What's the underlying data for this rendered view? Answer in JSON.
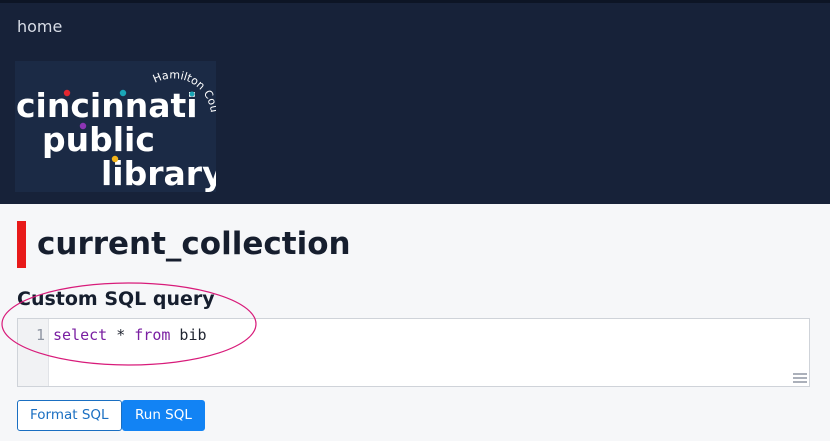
{
  "nav": {
    "home_label": "home"
  },
  "logo": {
    "line1": "cincinnati",
    "line2": "public",
    "line3": "library",
    "arc_text": "Hamilton County",
    "alt": "Cincinnati & Hamilton County Public Library logo"
  },
  "page": {
    "title": "current_collection",
    "section_title": "Custom SQL query"
  },
  "editor": {
    "line_number": "1",
    "keyword_select": "select",
    "star": " * ",
    "keyword_from": "from",
    "table": " bib"
  },
  "buttons": {
    "format_label": "Format SQL",
    "run_label": "Run SQL"
  },
  "colors": {
    "header_bg": "#172239",
    "accent_red": "#e81a1a",
    "primary_blue": "#1283f4",
    "annotation_pink": "#d81b7a"
  }
}
